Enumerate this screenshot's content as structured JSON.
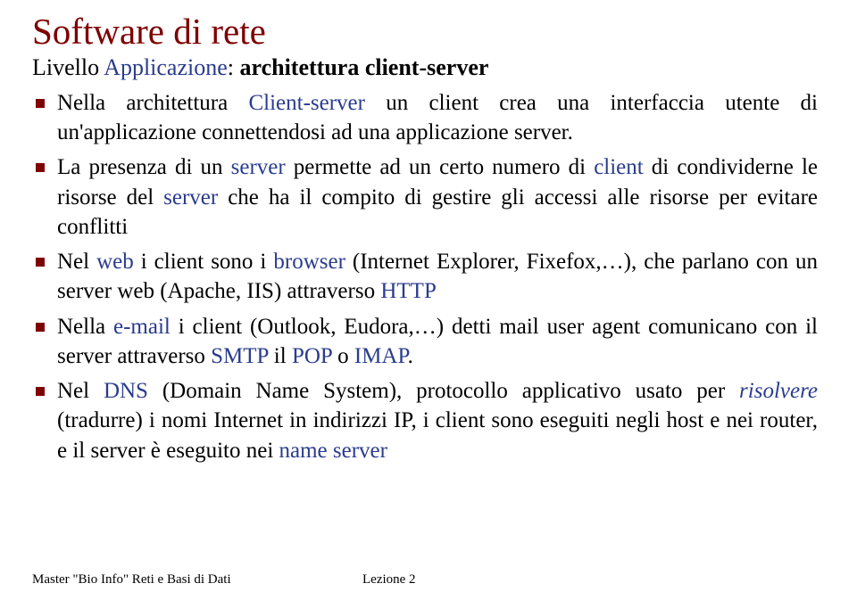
{
  "title": "Software di rete",
  "subtitle": {
    "pre": "Livello ",
    "blue1": "Applicazione",
    "mid": ": ",
    "bold": "architettura client-server"
  },
  "items": [
    {
      "spans": [
        {
          "t": "Nella architettura ",
          "c": false
        },
        {
          "t": "Client-server",
          "c": true
        },
        {
          "t": " un client crea una interfaccia utente di un'applicazione connettendosi ad una applicazione server.",
          "c": false
        }
      ]
    },
    {
      "spans": [
        {
          "t": "La presenza di un ",
          "c": false
        },
        {
          "t": "server",
          "c": true
        },
        {
          "t": " permette ad un certo numero di ",
          "c": false
        },
        {
          "t": "client",
          "c": true
        },
        {
          "t": " di condividerne le risorse del ",
          "c": false
        },
        {
          "t": "server",
          "c": true
        },
        {
          "t": " che ha il compito di gestire gli accessi alle risorse per evitare conflitti",
          "c": false
        }
      ]
    },
    {
      "spans": [
        {
          "t": "Nel ",
          "c": false
        },
        {
          "t": "web",
          "c": true
        },
        {
          "t": " i client sono i ",
          "c": false
        },
        {
          "t": "browser",
          "c": true
        },
        {
          "t": " (Internet Explorer, Fixefox,…), che parlano con un server web (Apache, IIS) attraverso ",
          "c": false
        },
        {
          "t": "HTTP",
          "c": true
        }
      ]
    },
    {
      "spans": [
        {
          "t": "Nella ",
          "c": false
        },
        {
          "t": "e-mail",
          "c": true
        },
        {
          "t": " i client (Outlook, Eudora,…) detti mail user agent comunicano con il server attraverso ",
          "c": false
        },
        {
          "t": " SMTP",
          "c": true
        },
        {
          "t": " il ",
          "c": false
        },
        {
          "t": "POP",
          "c": true
        },
        {
          "t": " o ",
          "c": false
        },
        {
          "t": "IMAP",
          "c": true
        },
        {
          "t": ".",
          "c": false
        }
      ]
    },
    {
      "spans": [
        {
          "t": "Nel ",
          "c": false
        },
        {
          "t": "DNS",
          "c": true
        },
        {
          "t": " (Domain Name System), protocollo applicativo usato per ",
          "c": false
        },
        {
          "t": "risolvere",
          "c": true,
          "i": true
        },
        {
          "t": " (tradurre) i nomi Internet in indirizzi IP, i client sono eseguiti negli host e nei router, e il server è eseguito nei ",
          "c": false
        },
        {
          "t": "name server",
          "c": true
        }
      ]
    }
  ],
  "footer": {
    "left": "Master \"Bio Info\" Reti e Basi di Dati",
    "center": "Lezione 2"
  }
}
